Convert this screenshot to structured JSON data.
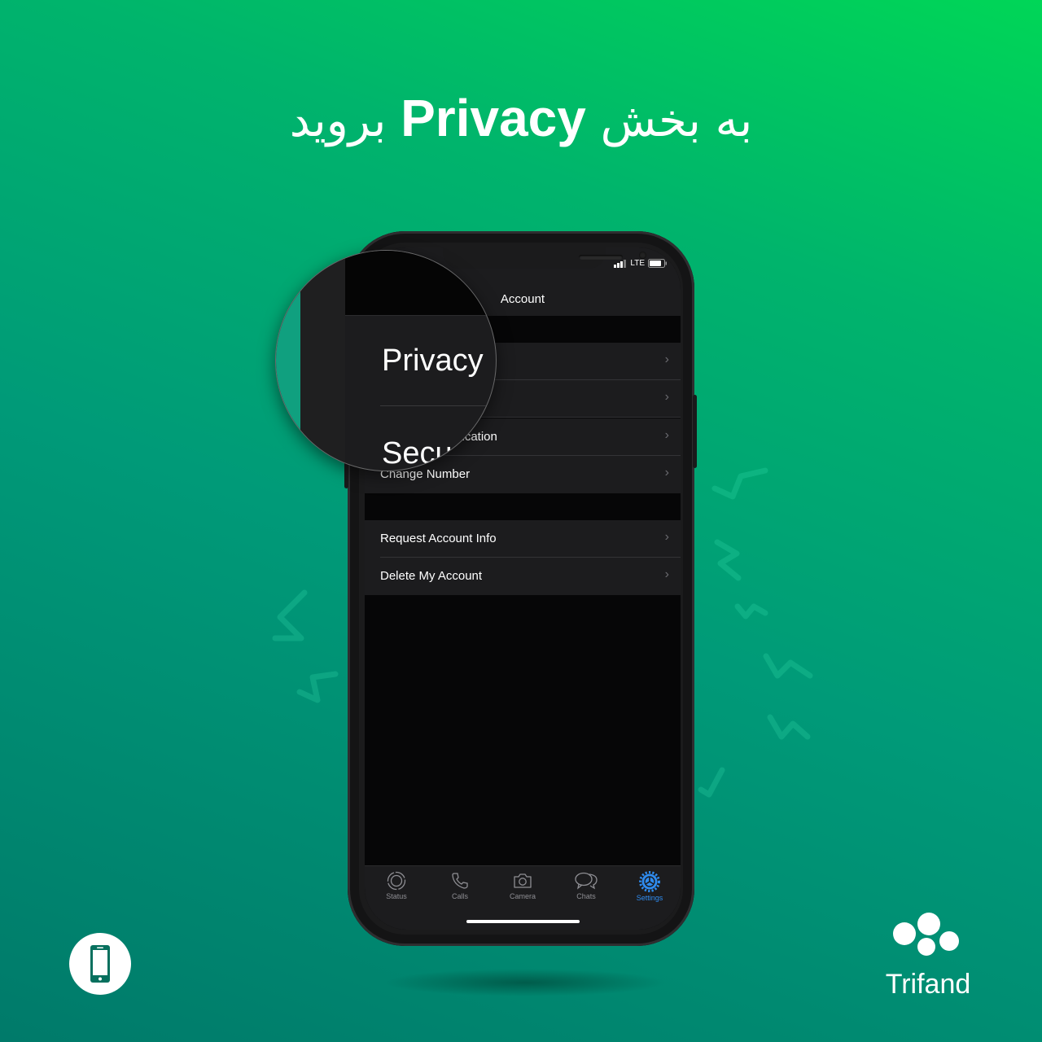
{
  "headline": {
    "pre": "به بخش",
    "keyword": "Privacy",
    "post": "بروید"
  },
  "status_bar": {
    "network": "LTE",
    "signal_icon": "signal-bars-icon",
    "battery_icon": "battery-icon"
  },
  "nav": {
    "title": "Account"
  },
  "magnifier": {
    "text_1": "Privacy",
    "text_2": "Secu"
  },
  "sections": [
    {
      "rows": [
        {
          "label": ""
        },
        {
          "label": ""
        },
        {
          "label": "ification"
        },
        {
          "label": "Change Number"
        }
      ]
    },
    {
      "rows": [
        {
          "label": "Request Account Info"
        },
        {
          "label": "Delete My Account"
        }
      ]
    }
  ],
  "tabs": [
    {
      "label": "Status",
      "icon": "status-icon",
      "active": false
    },
    {
      "label": "Calls",
      "icon": "phone-icon",
      "active": false
    },
    {
      "label": "Camera",
      "icon": "camera-icon",
      "active": false
    },
    {
      "label": "Chats",
      "icon": "chat-bubbles-icon",
      "active": false
    },
    {
      "label": "Settings",
      "icon": "gear-icon",
      "active": true
    }
  ],
  "colors": {
    "accent": "#2f8cf0",
    "brand_green": "#00b46c"
  },
  "brand": {
    "name": "Trifand"
  }
}
